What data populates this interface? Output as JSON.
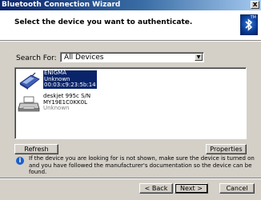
{
  "window": {
    "title": "Bluetooth Connection Wizard",
    "close_label": "x"
  },
  "header": {
    "heading": "Select the device you want to authenticate.",
    "logo_mark": "TM"
  },
  "search": {
    "label": "Search For:",
    "selected": "All Devices",
    "arrow": "▼"
  },
  "devices": [
    {
      "name": "ENIGMA",
      "status": "Unknown",
      "address": "00:03:c9:23:5b:14",
      "icon": "phone-icon",
      "selected": true
    },
    {
      "name": "deskjet 995c S/N",
      "address": "MY19E1C0KK0L",
      "status": "Unknown",
      "icon": "printer-icon",
      "selected": false
    }
  ],
  "buttons": {
    "refresh": "Refresh",
    "properties": "Properties",
    "back": "< Back",
    "next": "Next >",
    "cancel": "Cancel"
  },
  "info": {
    "icon": "info-icon",
    "text": "If the device you are looking for is not shown, make sure the device is turned on and you have followed the manufacturer's documentation so the device can be found."
  },
  "colors": {
    "title_bar_start": "#0a246a",
    "title_bar_end": "#a6caf0",
    "selection": "#0a246a",
    "dialog_face": "#d4d0c8"
  }
}
